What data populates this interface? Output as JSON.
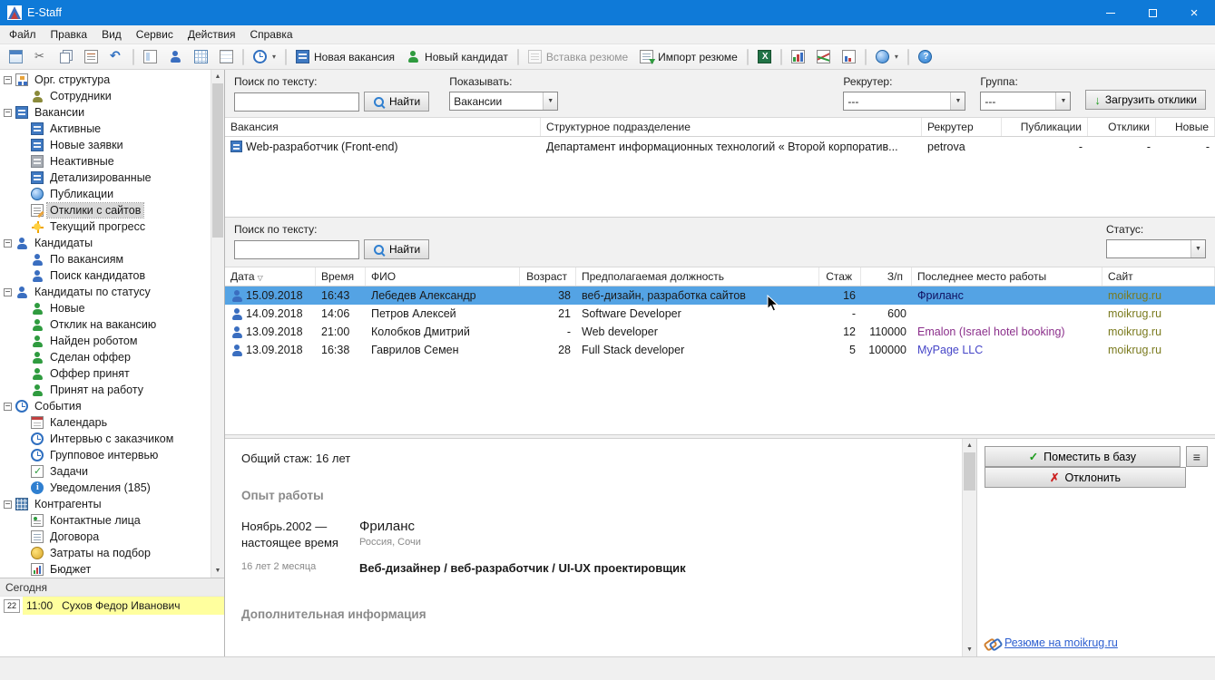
{
  "window": {
    "title": "E-Staff"
  },
  "colors": {
    "titlebar": "#0f7ad8",
    "selection_blue": "#54a3e4",
    "site_link": "#7a7a1e",
    "visited_link": "#8b2f8b",
    "link_blue": "#4646c8",
    "accent_green": "#1f9d1f",
    "accent_red": "#cc2222",
    "today_highlight": "#ffff9e"
  },
  "menu": {
    "items": [
      {
        "name": "menu-file",
        "label": "Файл"
      },
      {
        "name": "menu-edit",
        "label": "Правка"
      },
      {
        "name": "menu-view",
        "label": "Вид"
      },
      {
        "name": "menu-service",
        "label": "Сервис"
      },
      {
        "name": "menu-actions",
        "label": "Действия"
      },
      {
        "name": "menu-help",
        "label": "Справка"
      }
    ]
  },
  "toolbar": {
    "items": [
      {
        "name": "properties-button",
        "icon": "window"
      },
      {
        "name": "cut-button",
        "icon": "cut"
      },
      {
        "name": "copy-button",
        "icon": "copy"
      },
      {
        "name": "reports-button",
        "icon": "report"
      },
      {
        "name": "undo-button",
        "icon": "undo"
      },
      {
        "name": "toolbar-separator",
        "sep": true
      },
      {
        "name": "card-view-button",
        "icon": "form"
      },
      {
        "name": "employees-button",
        "icon": "person-blue"
      },
      {
        "name": "table-view-button",
        "icon": "grid"
      },
      {
        "name": "list-view-button",
        "icon": "sheet"
      },
      {
        "name": "toolbar-separator",
        "sep": true
      },
      {
        "name": "history-button",
        "icon": "clock",
        "dropdown": true
      },
      {
        "name": "toolbar-separator",
        "sep": true
      },
      {
        "name": "new-vacancy-button",
        "icon": "newvac",
        "label": "Новая вакансия"
      },
      {
        "name": "new-candidate-button",
        "icon": "person-new",
        "label": "Новый кандидат"
      },
      {
        "name": "toolbar-separator",
        "sep": true
      },
      {
        "name": "paste-resume-button",
        "icon": "doc-gray",
        "label": "Вставка резюме",
        "disabled": true
      },
      {
        "name": "import-resume-button",
        "icon": "doc-import",
        "label": "Импорт резюме"
      },
      {
        "name": "toolbar-separator",
        "sep": true
      },
      {
        "name": "excel-export-button",
        "icon": "excel"
      },
      {
        "name": "toolbar-separator",
        "sep": true
      },
      {
        "name": "bar-chart-button",
        "icon": "chart-bar"
      },
      {
        "name": "line-chart-button",
        "icon": "chart-line"
      },
      {
        "name": "report-chart-button",
        "icon": "chart-doc"
      },
      {
        "name": "toolbar-separator",
        "sep": true
      },
      {
        "name": "web-publications-button",
        "icon": "globe",
        "dropdown": true
      },
      {
        "name": "toolbar-separator",
        "sep": true
      },
      {
        "name": "help-button",
        "icon": "help"
      }
    ]
  },
  "sidebar": {
    "tree": [
      {
        "name": "sidebar-item-org-structure",
        "label": "Орг. структура",
        "depth": 0,
        "exp": "−",
        "icon": "org"
      },
      {
        "name": "sidebar-item-employees",
        "label": "Сотрудники",
        "depth": 1,
        "icon": "person-olive"
      },
      {
        "name": "sidebar-item-vacancies",
        "label": "Вакансии",
        "depth": 0,
        "exp": "−",
        "icon": "vacancy"
      },
      {
        "name": "sidebar-item-active",
        "label": "Активные",
        "depth": 1,
        "icon": "vacancy"
      },
      {
        "name": "sidebar-item-new-requests",
        "label": "Новые заявки",
        "depth": 1,
        "icon": "vacancy"
      },
      {
        "name": "sidebar-item-inactive",
        "label": "Неактивные",
        "depth": 1,
        "icon": "vacancy-gray"
      },
      {
        "name": "sidebar-item-detailed",
        "label": "Детализированные",
        "depth": 1,
        "icon": "vacancy"
      },
      {
        "name": "sidebar-item-publications",
        "label": "Публикации",
        "depth": 1,
        "icon": "globe"
      },
      {
        "name": "sidebar-item-site-responses",
        "label": "Отклики с сайтов",
        "depth": 1,
        "icon": "responses",
        "selected": true
      },
      {
        "name": "sidebar-item-current-progress",
        "label": "Текущий прогресс",
        "depth": 1,
        "icon": "sun"
      },
      {
        "name": "sidebar-item-candidates",
        "label": "Кандидаты",
        "depth": 0,
        "exp": "−",
        "icon": "person-blue"
      },
      {
        "name": "sidebar-item-by-vacancies",
        "label": "По вакансиям",
        "depth": 1,
        "icon": "person-blue"
      },
      {
        "name": "sidebar-item-candidate-search",
        "label": "Поиск кандидатов",
        "depth": 1,
        "icon": "person-blue"
      },
      {
        "name": "sidebar-item-candidates-by-status",
        "label": "Кандидаты по статусу",
        "depth": 0,
        "exp": "−",
        "icon": "person-blue"
      },
      {
        "name": "sidebar-item-new",
        "label": "Новые",
        "depth": 1,
        "icon": "person-green"
      },
      {
        "name": "sidebar-item-vacancy-response",
        "label": "Отклик на вакансию",
        "depth": 1,
        "icon": "person-green"
      },
      {
        "name": "sidebar-item-found-by-robot",
        "label": "Найден роботом",
        "depth": 1,
        "icon": "person-green"
      },
      {
        "name": "sidebar-item-offer-made",
        "label": "Сделан оффер",
        "depth": 1,
        "icon": "person-green"
      },
      {
        "name": "sidebar-item-offer-accepted",
        "label": "Оффер принят",
        "depth": 1,
        "icon": "person-green"
      },
      {
        "name": "sidebar-item-hired",
        "label": "Принят на работу",
        "depth": 1,
        "icon": "person-green"
      },
      {
        "name": "sidebar-item-events",
        "label": "События",
        "depth": 0,
        "exp": "−",
        "icon": "clock"
      },
      {
        "name": "sidebar-item-calendar",
        "label": "Календарь",
        "depth": 1,
        "icon": "calendar"
      },
      {
        "name": "sidebar-item-customer-interview",
        "label": "Интервью с заказчиком",
        "depth": 1,
        "icon": "clock"
      },
      {
        "name": "sidebar-item-group-interview",
        "label": "Групповое интервью",
        "depth": 1,
        "icon": "clock"
      },
      {
        "name": "sidebar-item-tasks",
        "label": "Задачи",
        "depth": 1,
        "icon": "task"
      },
      {
        "name": "sidebar-item-notifications",
        "label": "Уведомления  (185)",
        "depth": 1,
        "icon": "info"
      },
      {
        "name": "sidebar-item-counterparties",
        "label": "Контрагенты",
        "depth": 0,
        "exp": "−",
        "icon": "building"
      },
      {
        "name": "sidebar-item-contact-persons",
        "label": "Контактные лица",
        "depth": 1,
        "icon": "contacts"
      },
      {
        "name": "sidebar-item-contracts",
        "label": "Договора",
        "depth": 1,
        "icon": "doc"
      },
      {
        "name": "sidebar-item-recruitment-costs",
        "label": "Затраты на подбор",
        "depth": 1,
        "icon": "money"
      },
      {
        "name": "sidebar-item-budget",
        "label": "Бюджет",
        "depth": 1,
        "icon": "chart"
      }
    ],
    "today": {
      "header": "Сегодня",
      "day": "22",
      "time": "11:00",
      "person": "Сухов Федор Иванович"
    }
  },
  "vacancy_filter": {
    "search_label": "Поиск по тексту:",
    "search_value": "",
    "find_label": "Найти",
    "show_label": "Показывать:",
    "show_value": "Вакансии",
    "recruiter_label": "Рекрутер:",
    "recruiter_value": "---",
    "group_label": "Группа:",
    "group_value": "---",
    "load_button": "Загрузить отклики"
  },
  "vacancies": {
    "columns": [
      {
        "label": "Вакансия"
      },
      {
        "label": "Структурное подразделение"
      },
      {
        "label": "Рекрутер"
      },
      {
        "label": "Публикации",
        "align": "right"
      },
      {
        "label": "Отклики",
        "align": "right"
      },
      {
        "label": "Новые",
        "align": "right"
      }
    ],
    "row": {
      "name": "Web-разработчик (Front-end)",
      "department": "Департамент информационных технологий  «  Второй корпоратив...",
      "recruiter": "petrova",
      "publications": "-",
      "responses": "-",
      "new": "-"
    }
  },
  "candidate_filter": {
    "search_label": "Поиск по тексту:",
    "search_value": "",
    "find_label": "Найти",
    "status_label": "Статус:",
    "status_value": ""
  },
  "candidates": {
    "columns": [
      {
        "label": "Дата",
        "sort": "▽"
      },
      {
        "label": "Время"
      },
      {
        "label": "ФИО"
      },
      {
        "label": "Возраст",
        "align": "right"
      },
      {
        "label": "Предполагаемая должность"
      },
      {
        "label": "Стаж",
        "align": "right"
      },
      {
        "label": "З/п",
        "align": "right"
      },
      {
        "label": "Последнее место работы"
      },
      {
        "label": "Сайт"
      }
    ],
    "rows": [
      {
        "date": "15.09.2018",
        "time": "16:43",
        "fio": "Лебедев Александр",
        "age": "38",
        "position": "веб-дизайн, разработка сайтов",
        "experience": "16",
        "salary": "",
        "last_work": "Фриланс",
        "work_color": "#101060",
        "site": "moikrug.ru",
        "selected": true
      },
      {
        "date": "14.09.2018",
        "time": "14:06",
        "fio": "Петров Алексей",
        "age": "21",
        "position": "Software Developer",
        "experience": "-",
        "salary": "600",
        "last_work": "",
        "site": "moikrug.ru"
      },
      {
        "date": "13.09.2018",
        "time": "21:00",
        "fio": "Колобков Дмитрий",
        "age": "-",
        "position": "Web developer",
        "experience": "12",
        "salary": "110000",
        "last_work": "Emalon (Israel hotel booking)",
        "work_color": "#8b2f8b",
        "site": "moikrug.ru"
      },
      {
        "date": "13.09.2018",
        "time": "16:38",
        "fio": "Гаврилов Семен",
        "age": "28",
        "position": "Full Stack developer",
        "experience": "5",
        "salary": "100000",
        "last_work": "MyPage LLC",
        "work_color": "#4646c8",
        "site": "moikrug.ru"
      }
    ]
  },
  "detail": {
    "total_experience": "Общий стаж: 16 лет",
    "experience_heading": "Опыт работы",
    "period": "Ноябрь.2002 —\nнастоящее время",
    "duration": "16 лет 2 месяца",
    "company": "Фриланс",
    "location": "Россия, Сочи",
    "position": "Веб-дизайнер / веб-разработчик / UI-UX проектировщик",
    "additional_heading": "Дополнительная информация"
  },
  "actions": {
    "accept_label": "Поместить в базу",
    "reject_label": "Отклонить",
    "resume_link_label": "Резюме на moikrug.ru"
  }
}
